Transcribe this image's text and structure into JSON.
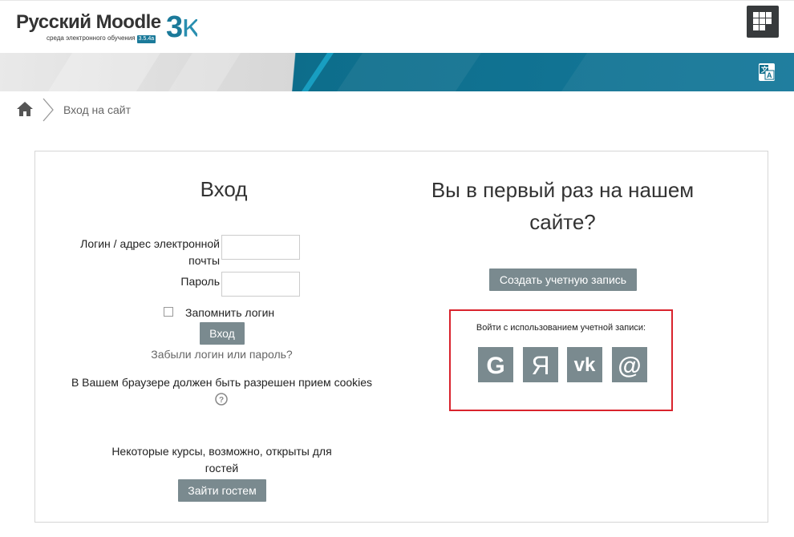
{
  "header": {
    "logo_text": "Русский Moodle",
    "logo_3k": "3K",
    "logo_subtitle": "среда электронного обучения",
    "logo_version": "3.5.4a"
  },
  "breadcrumb": {
    "current": "Вход на сайт"
  },
  "login": {
    "title": "Вход",
    "username_label": "Логин / адрес электронной почты",
    "username_value": "",
    "password_label": "Пароль",
    "password_value": "",
    "remember_label": "Запомнить логин",
    "remember_checked": false,
    "submit_label": "Вход",
    "forgot_link": "Забыли логин или пароль?",
    "cookies_notice": "В Вашем браузере должен быть разрешен прием cookies",
    "guest_notice": "Некоторые курсы, возможно, открыты для гостей",
    "guest_button": "Зайти гостем"
  },
  "signup": {
    "title": "Вы в первый раз на нашем сайте?",
    "create_button": "Создать учетную запись"
  },
  "oauth": {
    "label": "Войти с использованием учетной записи:",
    "providers": [
      {
        "name": "google",
        "glyph": "G"
      },
      {
        "name": "yandex",
        "glyph": "Я"
      },
      {
        "name": "vk",
        "glyph": "vk"
      },
      {
        "name": "mail",
        "glyph": "@"
      }
    ]
  },
  "colors": {
    "button_bg": "#7a8a8f",
    "banner_blue": "#0d6e8c",
    "highlight_border": "#d9232d"
  }
}
